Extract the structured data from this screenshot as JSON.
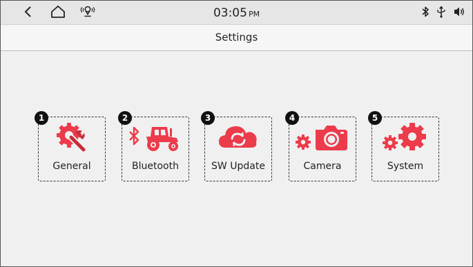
{
  "status_bar": {
    "time": "03:05",
    "ampm": "PM",
    "back_icon": "back-chevron-icon",
    "home_icon": "home-icon",
    "location_icon": "location-signal-icon",
    "bluetooth_icon": "bluetooth-icon",
    "usb_icon": "usb-icon",
    "volume_icon": "volume-icon"
  },
  "header": {
    "title": "Settings"
  },
  "tiles": [
    {
      "number": "1",
      "label": "General",
      "icon": "gear-wrench-icon"
    },
    {
      "number": "2",
      "label": "Bluetooth",
      "icon": "bluetooth-tractor-icon"
    },
    {
      "number": "3",
      "label": "SW Update",
      "icon": "cloud-sync-icon"
    },
    {
      "number": "4",
      "label": "Camera",
      "icon": "gear-camera-icon"
    },
    {
      "number": "5",
      "label": "System",
      "icon": "gears-icon"
    }
  ],
  "colors": {
    "accent": "#ec3b4a",
    "accent_dark": "#c72c3a",
    "statusbar_bg": "#e6e6e6",
    "content_bg": "#f0f0f0"
  }
}
